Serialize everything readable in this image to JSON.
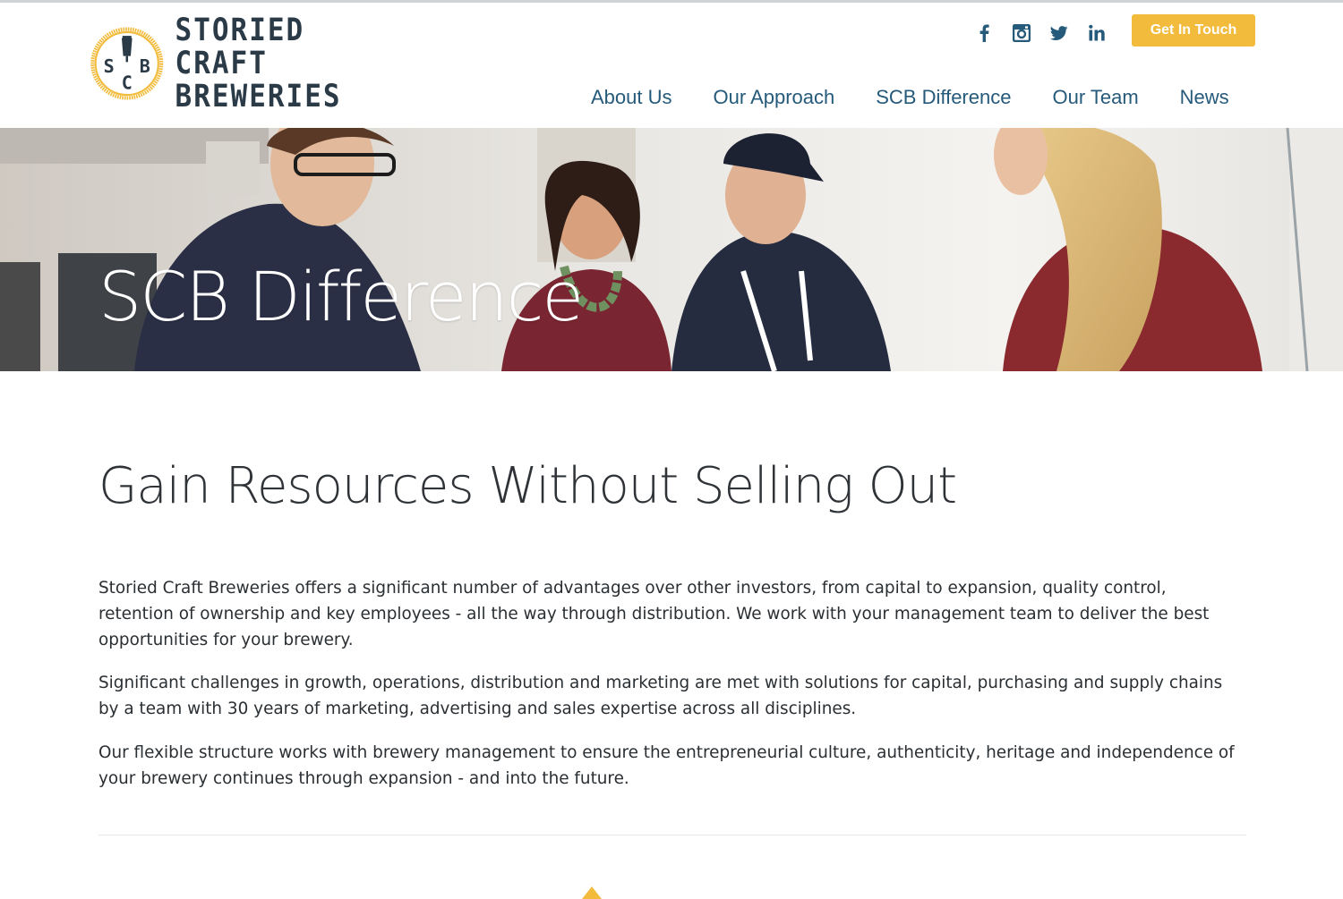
{
  "brand": {
    "seal_letters": [
      "S",
      "C",
      "B"
    ],
    "name_line1": "STORIED CRAFT",
    "name_line2": "BREWERIES",
    "brand_color": "#f2bb3c",
    "text_color": "#2b3a47"
  },
  "social": [
    {
      "icon": "facebook-icon",
      "glyph": "f"
    },
    {
      "icon": "instagram-icon",
      "glyph": ""
    },
    {
      "icon": "twitter-icon",
      "glyph": ""
    },
    {
      "icon": "linkedin-icon",
      "glyph": "in"
    }
  ],
  "header": {
    "cta_label": "Get In Touch"
  },
  "nav": {
    "items": [
      {
        "label": "About Us"
      },
      {
        "label": "Our Approach"
      },
      {
        "label": "SCB Difference"
      },
      {
        "label": "Our Team"
      },
      {
        "label": "News"
      }
    ],
    "link_color": "#265a7b"
  },
  "hero": {
    "title": "SCB Difference"
  },
  "main": {
    "headline": "Gain Resources Without Selling Out",
    "paragraphs": [
      "Storied Craft Breweries offers a significant number of advantages over other investors, from capital to expansion, quality control, retention of ownership and key employees - all the way through distribution. We work with your management team to deliver the best opportunities for your brewery.",
      "Significant challenges in growth, operations, distribution and marketing are met with solutions for capital, purchasing and supply chains by a team with 30 years of marketing, advertising and sales expertise across all disciplines.",
      "Our flexible structure works with brewery management to ensure the entrepreneurial culture, authenticity, heritage and independence of your brewery continues through expansion - and into the future."
    ]
  }
}
